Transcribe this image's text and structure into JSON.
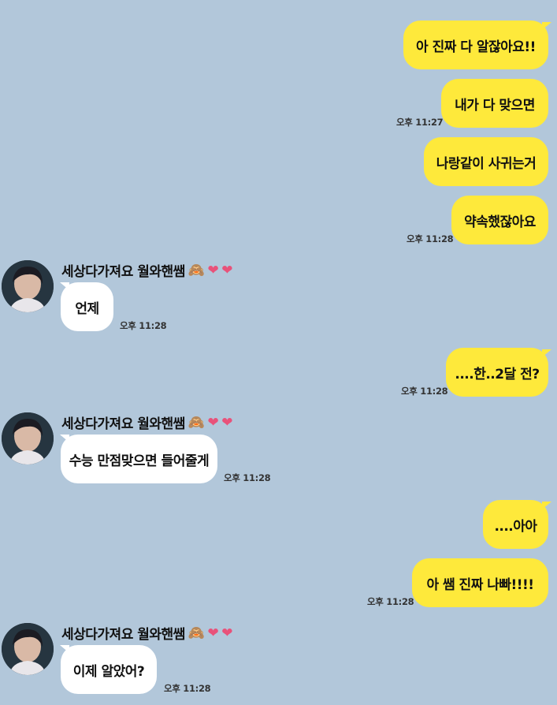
{
  "messages": [
    {
      "text": "아 진짜 다 알잖아요!!"
    },
    {
      "text": "내가 다 맞으면"
    },
    {
      "text": "나랑같이 사귀는거"
    },
    {
      "text": "약속했잖아요"
    },
    {
      "text": "언제"
    },
    {
      "text": "....한..2달 전?"
    },
    {
      "text": "수능 만점맞으면 들어줄게"
    },
    {
      "text": "....아아"
    },
    {
      "text": "아 쌤 진짜 나빠!!!!"
    },
    {
      "text": "이제 알았어?"
    }
  ],
  "times": {
    "t1": "오후 11:27",
    "t2": "오후 11:28",
    "t3": "오후 11:28",
    "t4": "오후 11:28",
    "t5": "오후 11:28",
    "t6": "오후 11:28",
    "t7": "오후 11:28"
  },
  "sender": {
    "name": "세상다가져요 월와핸쌤",
    "emoji": "🙈",
    "hearts": [
      "❤",
      "❤"
    ]
  },
  "colors": {
    "background": "#b2c7da",
    "my_bubble": "#fee93b",
    "their_bubble": "#ffffff",
    "heart": "#e8527a"
  }
}
